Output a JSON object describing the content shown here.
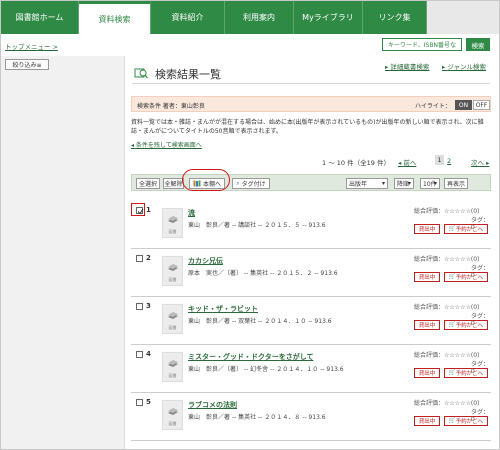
{
  "nav": {
    "tabs": [
      "図書館ホーム",
      "資料検索",
      "資料紹介",
      "利用案内",
      "Myライブラリ",
      "リンク集"
    ],
    "active_index": 1
  },
  "breadcrumb": "トップメニュー >",
  "quick_search": {
    "placeholder": "キーワード、ISBN番号な",
    "button": "検索"
  },
  "sidebar": {
    "refine_label": "絞り込み≡"
  },
  "header": {
    "title": "検索結果一覧",
    "link_detail": "詳細蔵書検索",
    "link_genre": "ジャンル検索"
  },
  "condition": {
    "text": "検索条件 著者：東山彰良",
    "highlight_label": "ハイライト：",
    "on": "ON",
    "off": "OFF"
  },
  "info_text": "資料一覧では本・雑誌・まんがが混在する場合は、始めに本(出版年が表示されているもの)が出版年の新しい順で表示され、次に雑誌・まんがについてタイトルの50音順で表示されます。",
  "info_link": "条件を残して検索画面へ",
  "pagination": {
    "count": "1 〜 10 件（全19 件）",
    "prev": "前へ",
    "pages": [
      "1",
      "2"
    ],
    "current": "1",
    "next": "次へ"
  },
  "toolbar": {
    "select_all": "全選択",
    "clear_all": "全解除",
    "to_shelf": "本棚へ",
    "tag": "タグ付け",
    "sort_field": "出版年",
    "sort_order": "降順",
    "per_page": "10件",
    "redisplay": "再表示"
  },
  "row_labels": {
    "rating": "総合評価：☆☆☆☆☆(0)",
    "tag": "タグ：0",
    "lent": "貸出中",
    "reserve": "予約かごへ",
    "thumb": "図書"
  },
  "results": [
    {
      "num": "1",
      "title": "流",
      "desc": "東山　彰良／著 -- 講談社 -- ２０１５．５ -- 913.6",
      "checked": true
    },
    {
      "num": "2",
      "title": "カカシ兄伝",
      "desc": "原本　実也／〔著〕 -- 集英社 -- ２０１５．２ -- 913.6",
      "checked": false
    },
    {
      "num": "3",
      "title": "キッド・ザ・ラビット",
      "desc": "東山　彰良／著 -- 双葉社 -- ２０１４．１０ -- 913.6",
      "checked": false
    },
    {
      "num": "4",
      "title": "ミスター・グッド・ドクターをさがして",
      "desc": "東山　彰良／〔著〕 -- 幻冬舎 -- ２０１４．１０ -- 913.6",
      "checked": false
    },
    {
      "num": "5",
      "title": "ラブコメの法則",
      "desc": "東山　彰良／著 -- 集英社 -- ２０１４．８ -- 913.6",
      "checked": false
    }
  ]
}
